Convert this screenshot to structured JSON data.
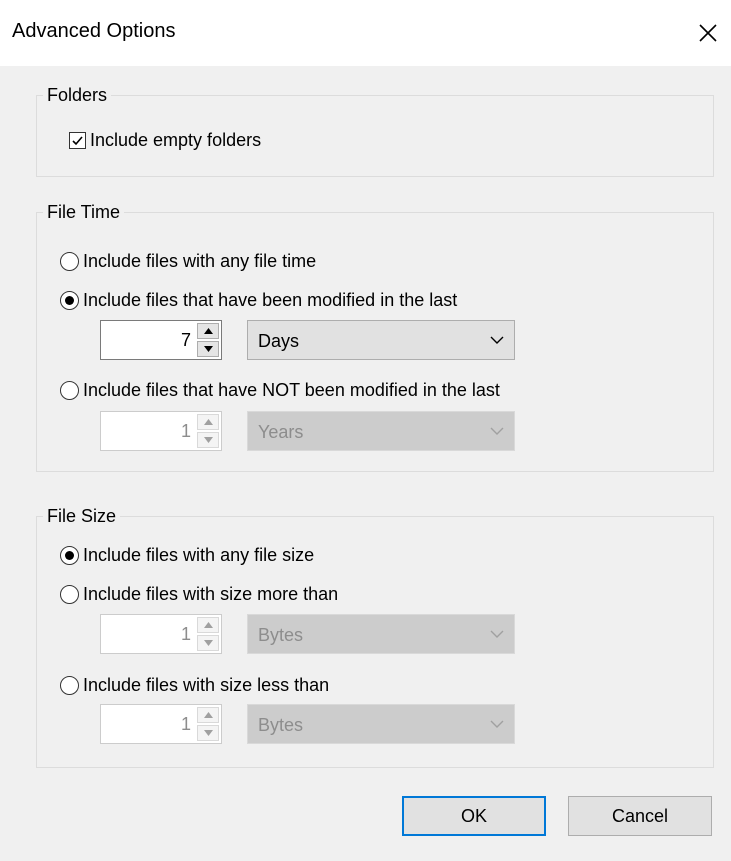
{
  "dialog": {
    "title": "Advanced Options",
    "close_icon": "close-icon"
  },
  "folders": {
    "legend": "Folders",
    "include_empty": {
      "label": "Include empty folders",
      "checked": true
    }
  },
  "file_time": {
    "legend": "File Time",
    "options": [
      {
        "label": "Include files with any file time",
        "selected": false
      },
      {
        "label": "Include files that have been modified in the last",
        "selected": true
      },
      {
        "label": "Include files that have NOT been modified in the last",
        "selected": false
      }
    ],
    "modified": {
      "value": "7",
      "unit": "Days",
      "enabled": true
    },
    "not_modified": {
      "value": "1",
      "unit": "Years",
      "enabled": false
    }
  },
  "file_size": {
    "legend": "File Size",
    "options": [
      {
        "label": "Include files with any file size",
        "selected": true
      },
      {
        "label": "Include files with size more than",
        "selected": false
      },
      {
        "label": "Include files with size less than",
        "selected": false
      }
    ],
    "more_than": {
      "value": "1",
      "unit": "Bytes",
      "enabled": false
    },
    "less_than": {
      "value": "1",
      "unit": "Bytes",
      "enabled": false
    }
  },
  "buttons": {
    "ok": "OK",
    "cancel": "Cancel"
  },
  "colors": {
    "accent": "#0078d7",
    "background": "#f0f0f0"
  }
}
